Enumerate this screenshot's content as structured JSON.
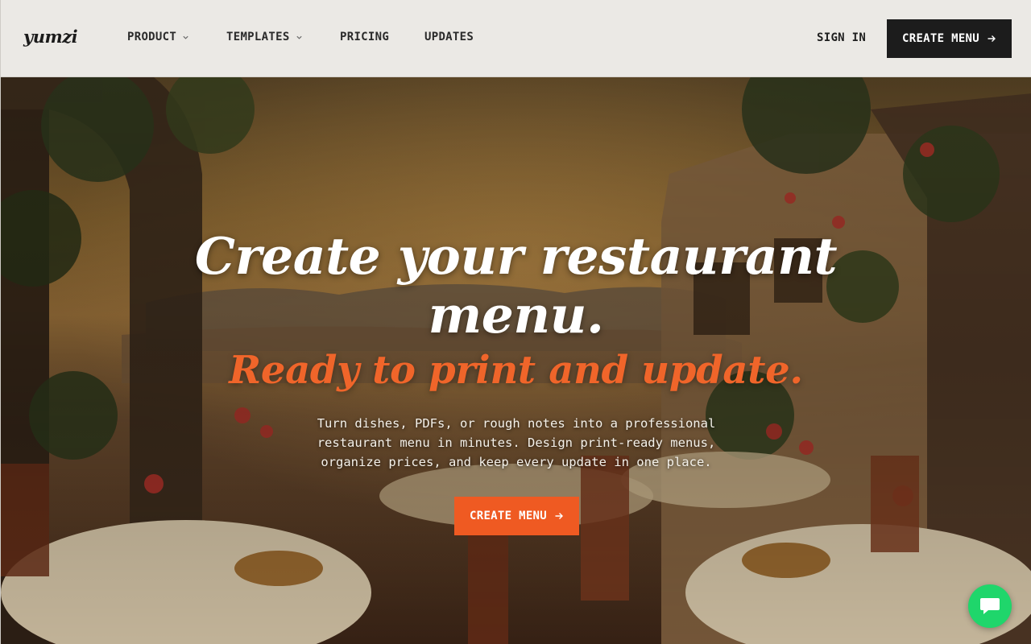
{
  "brand": {
    "logo_text": "yumzi"
  },
  "nav": {
    "items": [
      {
        "label": "PRODUCT",
        "has_dropdown": true
      },
      {
        "label": "TEMPLATES",
        "has_dropdown": true
      },
      {
        "label": "PRICING",
        "has_dropdown": false
      },
      {
        "label": "UPDATES",
        "has_dropdown": false
      }
    ]
  },
  "header": {
    "sign_in_label": "SIGN IN",
    "cta_label": "CREATE MENU"
  },
  "hero": {
    "title_line1": "Create your restaurant",
    "title_line2": "menu.",
    "subtitle": "Ready to print and update.",
    "description_line1": "Turn dishes, PDFs, or rough notes into a professional",
    "description_line2": "restaurant menu in minutes. Design print-ready menus,",
    "description_line3": "organize prices, and keep every update in one place.",
    "cta_label": "CREATE MENU",
    "background_description": "painted terrace restaurant scene"
  },
  "colors": {
    "accent": "#ef5a22",
    "dark_button": "#1c1c1c",
    "header_bg": "#ebe9e5",
    "chat": "#1fd66b"
  },
  "icons": {
    "nav_dropdown": "chevron-down-icon",
    "cta_arrow": "arrow-right-icon",
    "chat": "chat-icon"
  }
}
